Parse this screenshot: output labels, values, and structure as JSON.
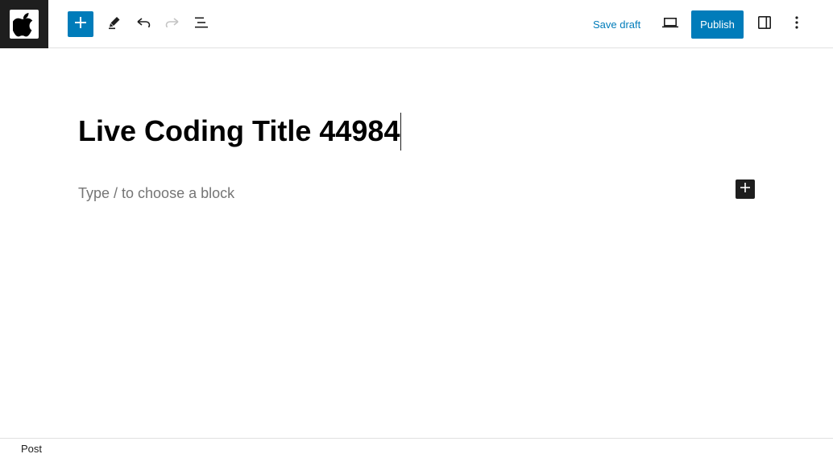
{
  "header": {
    "site_logo_icon": "apple-logo-icon",
    "inserter_icon": "plus-icon",
    "tools_icon": "pencil-icon",
    "undo_icon": "undo-icon",
    "redo_icon": "redo-icon",
    "list_view_icon": "list-view-icon",
    "save_draft_label": "Save draft",
    "preview_icon": "laptop-icon",
    "publish_label": "Publish",
    "settings_icon": "sidebar-toggle-icon",
    "options_icon": "vertical-ellipsis-icon"
  },
  "editor": {
    "title": "Live Coding Title 44984",
    "block_placeholder": "Type / to choose a block",
    "block_inserter_icon": "plus-icon"
  },
  "footer": {
    "breadcrumb": "Post"
  },
  "colors": {
    "accent": "#007cba",
    "dark": "#1e1e1e",
    "placeholder": "#757575",
    "border": "#e0e0e0"
  }
}
